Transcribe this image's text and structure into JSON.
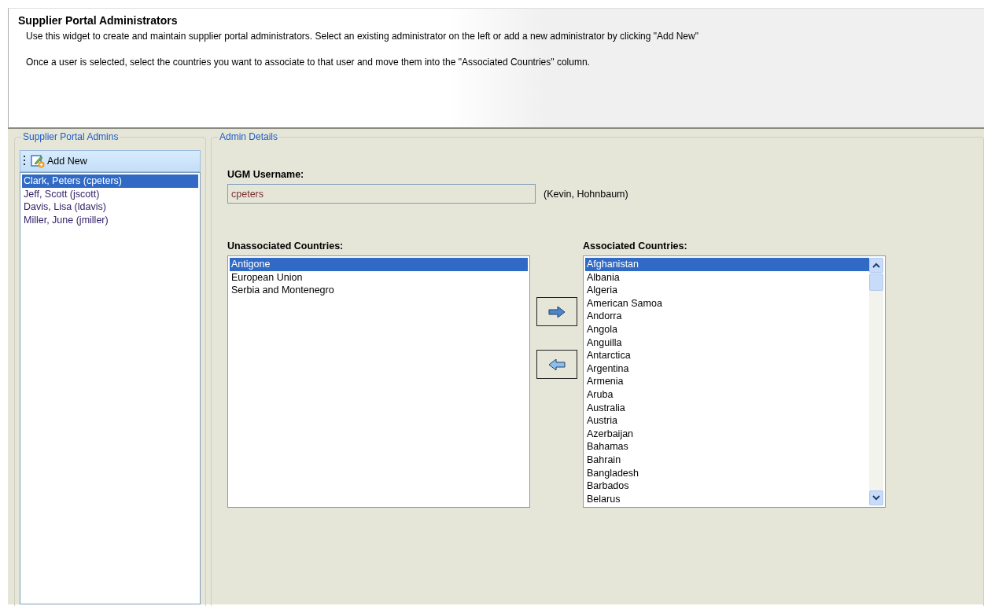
{
  "header": {
    "title": "Supplier Portal Administrators",
    "paragraphs": [
      "Use this widget to create and maintain supplier portal administrators. Select an existing administrator on the left or add a new administrator by clicking \"Add New\"",
      "Once a user is selected, select the countries you want to associate to that user and move them into the \"Associated Countries\" column."
    ]
  },
  "admins_panel": {
    "legend": "Supplier Portal Admins",
    "add_button": "Add New",
    "items": [
      {
        "label": "Clark, Peters (cpeters)",
        "selected": true
      },
      {
        "label": "Jeff, Scott (jscott)",
        "selected": false
      },
      {
        "label": "Davis, Lisa (ldavis)",
        "selected": false
      },
      {
        "label": "Miller, June (jmiller)",
        "selected": false
      }
    ]
  },
  "details": {
    "legend": "Admin Details",
    "username_label": "UGM Username:",
    "username_value": "cpeters",
    "username_display": "(Kevin, Hohnbaum)",
    "unassociated": {
      "label": "Unassociated Countries:",
      "items": [
        {
          "label": "Antigone",
          "selected": true
        },
        {
          "label": "European Union",
          "selected": false
        },
        {
          "label": "Serbia and Montenegro",
          "selected": false
        }
      ]
    },
    "associated": {
      "label": "Associated Countries:",
      "items": [
        {
          "label": "Afghanistan",
          "selected": true
        },
        {
          "label": "Albania",
          "selected": false
        },
        {
          "label": "Algeria",
          "selected": false
        },
        {
          "label": "American Samoa",
          "selected": false
        },
        {
          "label": "Andorra",
          "selected": false
        },
        {
          "label": "Angola",
          "selected": false
        },
        {
          "label": "Anguilla",
          "selected": false
        },
        {
          "label": "Antarctica",
          "selected": false
        },
        {
          "label": "Argentina",
          "selected": false
        },
        {
          "label": "Armenia",
          "selected": false
        },
        {
          "label": "Aruba",
          "selected": false
        },
        {
          "label": "Australia",
          "selected": false
        },
        {
          "label": "Austria",
          "selected": false
        },
        {
          "label": "Azerbaijan",
          "selected": false
        },
        {
          "label": "Bahamas",
          "selected": false
        },
        {
          "label": "Bahrain",
          "selected": false
        },
        {
          "label": "Bangladesh",
          "selected": false
        },
        {
          "label": "Barbados",
          "selected": false
        },
        {
          "label": "Belarus",
          "selected": false
        }
      ]
    }
  }
}
